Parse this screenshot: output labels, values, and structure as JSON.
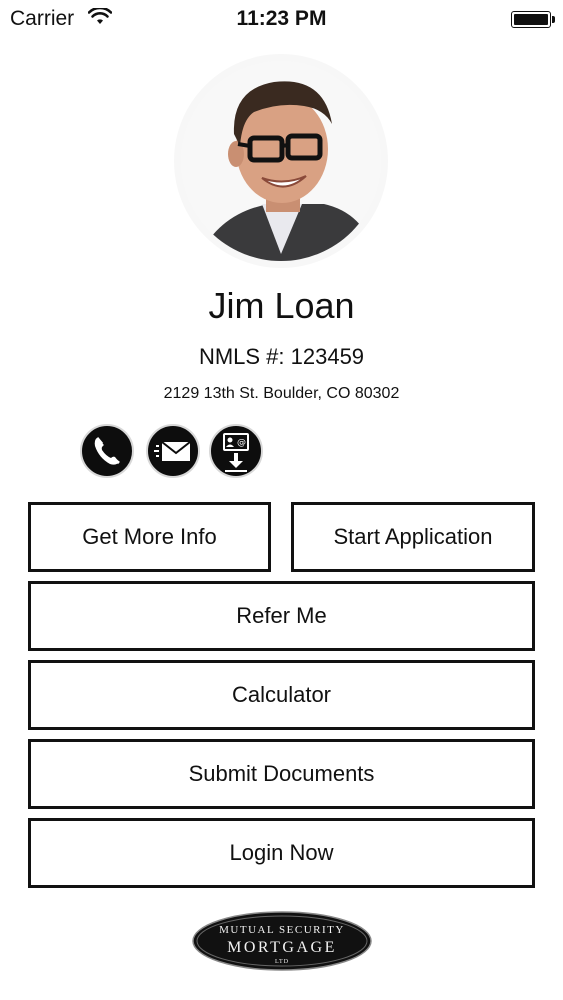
{
  "status_bar": {
    "carrier": "Carrier",
    "time": "11:23 PM",
    "battery_level": 1.0
  },
  "profile": {
    "name": "Jim Loan",
    "nmls": "NMLS #: 123459",
    "address": "2129 13th St.  Boulder, CO 80302"
  },
  "contact_icons": [
    "phone-icon",
    "email-icon",
    "vcard-download-icon"
  ],
  "buttons": {
    "get_more_info": "Get More Info",
    "start_application": "Start Application",
    "refer_me": "Refer Me",
    "calculator": "Calculator",
    "submit_documents": "Submit Documents",
    "login_now": "Login Now"
  },
  "logo": {
    "line1": "MUTUAL SECURITY",
    "line2": "MORTGAGE",
    "line3": "LTD"
  },
  "colors": {
    "button_border": "#111111",
    "icon_background": "#0d0d0d",
    "background": "#ffffff"
  }
}
